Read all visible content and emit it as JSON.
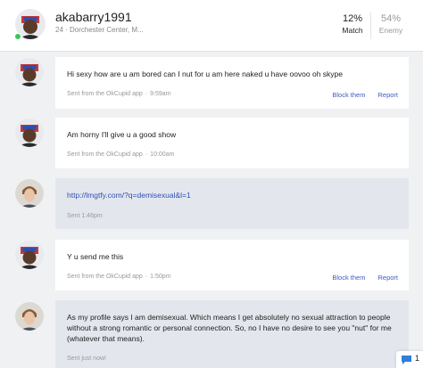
{
  "header": {
    "username": "akabarry1991",
    "location": "24 · Dorchester Center, M...",
    "match_pct": "12%",
    "match_label": "Match",
    "enemy_pct": "54%",
    "enemy_label": "Enemy",
    "online_color": "#38c75a"
  },
  "actions": {
    "block": "Block them",
    "report": "Report"
  },
  "messages": [
    {
      "sender": "them",
      "text": "Hi sexy how are u am bored can I nut for u am here naked u have oovoo oh skype",
      "via": "Sent from the OkCupid app",
      "time": "9:59am"
    },
    {
      "sender": "them",
      "text": "Am horny I'll give u a good show",
      "via": "Sent from the OkCupid app",
      "time": "10:00am"
    },
    {
      "sender": "me",
      "text": "http://lmgtfy.com/?q=demisexual&l=1",
      "status": "Sent 1:46pm"
    },
    {
      "sender": "them",
      "text": "Y u send me this",
      "via": "Sent from the OkCupid app",
      "time": "1:50pm"
    },
    {
      "sender": "me",
      "text": "As my profile says I am demisexual. Which means I get absolutely no sexual attraction to people without a strong romantic or personal connection. So, no I have no desire to see you \"nut\" for me (whatever that means).",
      "status": "Sent just now!"
    }
  ],
  "chat_badge": {
    "icon": "chat-bubble-icon",
    "count": "1",
    "color": "#2f7fd8"
  }
}
